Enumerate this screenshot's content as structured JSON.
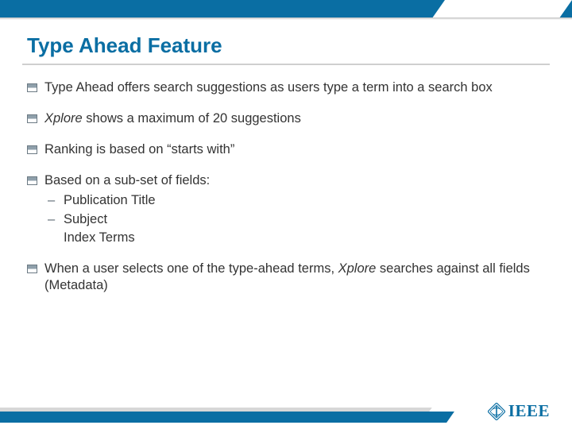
{
  "title": "Type Ahead Feature",
  "bullets": {
    "b1_pre": "Type Ahead offers search suggestions as users type a term into a search box",
    "b2_xplore": "Xplore",
    "b2_tail": " shows a maximum of 20 suggestions",
    "b3": "Ranking is based on “starts with”",
    "b4": "Based on a sub-set of fields:",
    "b4_sub1": "Publication Title",
    "b4_sub2": "Subject",
    "b4_sub3": "Index Terms",
    "b5_pre": "When a user selects one of the type-ahead terms, ",
    "b5_xplore": "Xplore",
    "b5_tail": " searches against all fields (Metadata)"
  },
  "logo_text": "IEEE",
  "colors": {
    "brand_blue": "#0a6ea3",
    "text": "#333333"
  }
}
